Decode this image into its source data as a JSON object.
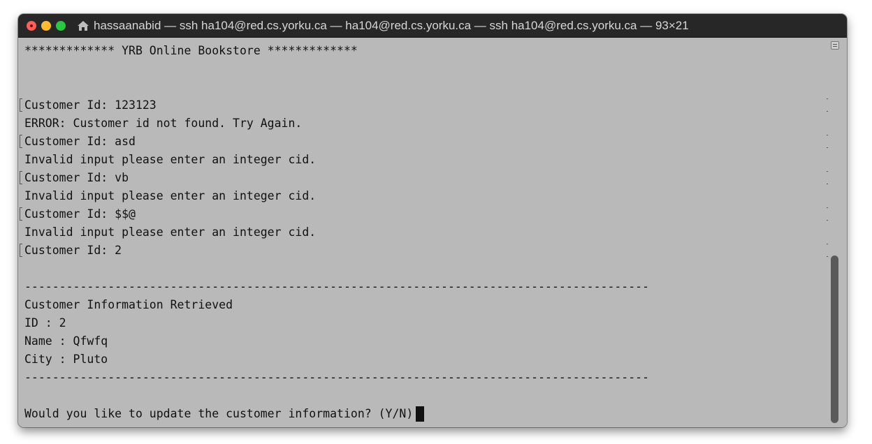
{
  "window": {
    "title": "hassaanabid — ssh ha104@red.cs.yorku.ca — ha104@red.cs.yorku.ca — ssh ha104@red.cs.yorku.ca — 93×21"
  },
  "icons": {
    "title_icon": "home-folder-icon",
    "scroll_button": "scroll-menu-icon"
  },
  "colors": {
    "terminal_background": "#b9b9b9",
    "titlebar_background": "#272727",
    "close": "#fe5f57",
    "minimize": "#febc2e",
    "zoom": "#28c840",
    "scroll_thumb": "#5a5a5a"
  },
  "terminal": {
    "lines": [
      {
        "text": "************* YRB Online Bookstore *************",
        "marked": false
      },
      {
        "text": "",
        "marked": false
      },
      {
        "text": "",
        "marked": false
      },
      {
        "text": "Customer Id: 123123",
        "marked": true
      },
      {
        "text": "ERROR: Customer id not found. Try Again.",
        "marked": false
      },
      {
        "text": "Customer Id: asd",
        "marked": true
      },
      {
        "text": "Invalid input please enter an integer cid.",
        "marked": false
      },
      {
        "text": "Customer Id: vb",
        "marked": true
      },
      {
        "text": "Invalid input please enter an integer cid.",
        "marked": false
      },
      {
        "text": "Customer Id: $$@",
        "marked": true
      },
      {
        "text": "Invalid input please enter an integer cid.",
        "marked": false
      },
      {
        "text": "Customer Id: 2",
        "marked": true
      },
      {
        "text": "",
        "marked": false
      },
      {
        "text": "------------------------------------------------------------------------------------------",
        "marked": false
      },
      {
        "text": "Customer Information Retrieved",
        "marked": false
      },
      {
        "text": "ID : 2",
        "marked": false
      },
      {
        "text": "Name : Qfwfq",
        "marked": false
      },
      {
        "text": "City : Pluto",
        "marked": false
      },
      {
        "text": "------------------------------------------------------------------------------------------",
        "marked": false
      },
      {
        "text": "",
        "marked": false
      },
      {
        "text": "Would you like to update the customer information? (Y/N)",
        "marked": false,
        "cursor": true
      }
    ]
  }
}
